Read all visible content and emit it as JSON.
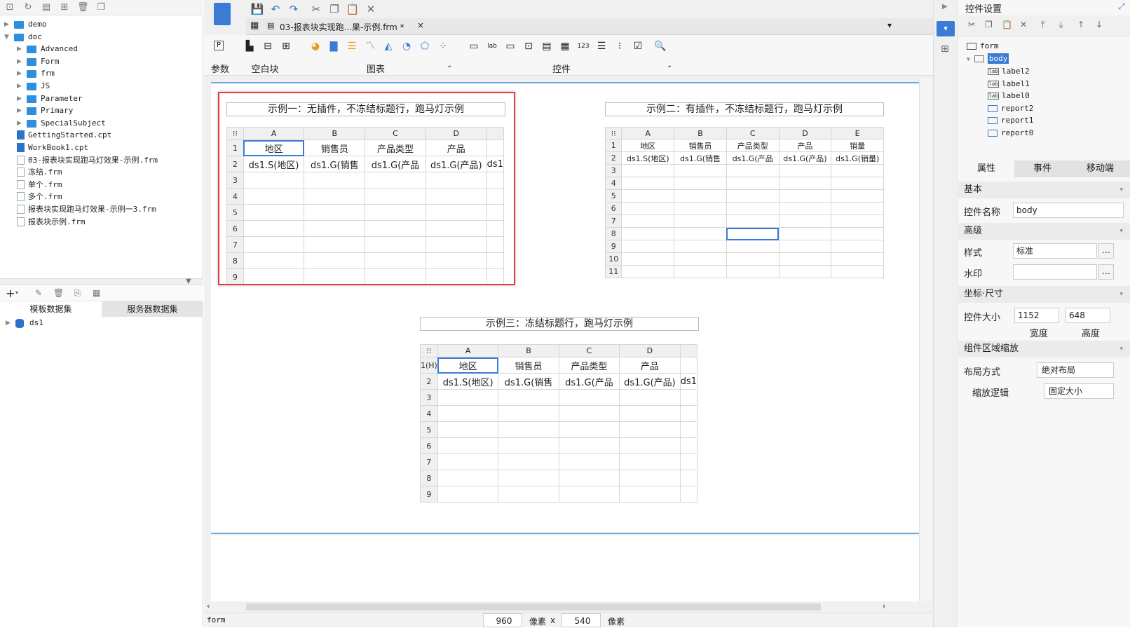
{
  "left_toolbar": {
    "icons": [
      "new-file-icon",
      "refresh-icon",
      "template-icon",
      "add-folder-icon",
      "delete-icon",
      "copy-icon"
    ]
  },
  "tree": [
    {
      "label": "demo",
      "type": "folder",
      "level": 0,
      "expanded": false
    },
    {
      "label": "doc",
      "type": "folder",
      "level": 0,
      "expanded": true
    },
    {
      "label": "Advanced",
      "type": "folder",
      "level": 1
    },
    {
      "label": "Form",
      "type": "folder",
      "level": 1
    },
    {
      "label": "frm",
      "type": "folder",
      "level": 1
    },
    {
      "label": "JS",
      "type": "folder",
      "level": 1
    },
    {
      "label": "Parameter",
      "type": "folder",
      "level": 1
    },
    {
      "label": "Primary",
      "type": "folder",
      "level": 1
    },
    {
      "label": "SpecialSubject",
      "type": "folder",
      "level": 1
    },
    {
      "label": "GettingStarted.cpt",
      "type": "cpt",
      "level": 0
    },
    {
      "label": "WorkBook1.cpt",
      "type": "cpt",
      "level": 0
    },
    {
      "label": "03-报表块实现跑马灯效果-示例.frm",
      "type": "frm",
      "level": 0
    },
    {
      "label": "冻结.frm",
      "type": "frm",
      "level": 0
    },
    {
      "label": "单个.frm",
      "type": "frm",
      "level": 0
    },
    {
      "label": "多个.frm",
      "type": "frm",
      "level": 0
    },
    {
      "label": "报表块实现跑马灯效果-示例一3.frm",
      "type": "frm",
      "level": 0
    },
    {
      "label": "报表块示例.frm",
      "type": "frm",
      "level": 0
    }
  ],
  "dataset_panel": {
    "tabs": [
      "模板数据集",
      "服务器数据集"
    ],
    "active_tab": 0,
    "items": [
      "ds1"
    ]
  },
  "editor_tab": {
    "title": "03-报表块实现跑...果-示例.frm *",
    "close": "×"
  },
  "ribbon": {
    "groups": [
      "参数",
      "空白块",
      "图表",
      "控件"
    ]
  },
  "examples": [
    {
      "title": "示例一：无插件，不冻结标题行，跑马灯示例",
      "cols": [
        "A",
        "B",
        "C",
        "D",
        ""
      ],
      "row_nums": [
        "1",
        "2",
        "3",
        "4",
        "5",
        "6",
        "7",
        "8",
        "9"
      ],
      "row1": [
        "地区",
        "销售员",
        "产品类型",
        "产品",
        ""
      ],
      "row2": [
        "ds1.S(地区)",
        "ds1.G(销售",
        "ds1.G(产品",
        "ds1.G(产品)",
        "ds1"
      ]
    },
    {
      "title": "示例二：有插件，不冻结标题行，跑马灯示例",
      "cols": [
        "A",
        "B",
        "C",
        "D",
        "E"
      ],
      "row_nums": [
        "1",
        "2",
        "3",
        "4",
        "5",
        "6",
        "7",
        "8",
        "9",
        "10",
        "11"
      ],
      "row1": [
        "地区",
        "销售员",
        "产品类型",
        "产品",
        "销量"
      ],
      "row2": [
        "ds1.S(地区)",
        "ds1.G(销售",
        "ds1.G(产品",
        "ds1.G(产品)",
        "ds1.G(销量)"
      ]
    },
    {
      "title": "示例三：冻结标题行，跑马灯示例",
      "cols": [
        "A",
        "B",
        "C",
        "D",
        ""
      ],
      "row_nums": [
        "1(H)",
        "2",
        "3",
        "4",
        "5",
        "6",
        "7",
        "8",
        "9"
      ],
      "row1": [
        "地区",
        "销售员",
        "产品类型",
        "产品",
        ""
      ],
      "row2": [
        "ds1.S(地区)",
        "ds1.G(销售",
        "ds1.G(产品",
        "ds1.G(产品)",
        "ds1"
      ]
    }
  ],
  "status": {
    "label": "form",
    "width": "960",
    "unit1": "像素",
    "x": "x",
    "height": "540",
    "unit2": "像素"
  },
  "right": {
    "title": "控件设置",
    "tree": {
      "root": "form",
      "body": "body",
      "children": [
        "label2",
        "label1",
        "label0",
        "report2",
        "report1",
        "report0"
      ]
    },
    "tabs": [
      "属性",
      "事件",
      "移动端"
    ],
    "sections": {
      "basic": "基本",
      "advanced": "高级",
      "coord": "坐标·尺寸",
      "scale": "组件区域缩放"
    },
    "fields": {
      "name_label": "控件名称",
      "name_value": "body",
      "style_label": "样式",
      "style_value": "标准",
      "watermark_label": "水印",
      "watermark_value": "",
      "size_label": "控件大小",
      "width_value": "1152",
      "height_value": "648",
      "width_caption": "宽度",
      "height_caption": "高度",
      "layout_label": "布局方式",
      "layout_value": "绝对布局",
      "scale_label": "缩放逻辑",
      "scale_value": "固定大小"
    }
  },
  "colors": {
    "accent": "#3a7bd5",
    "highlight_box": "#e23b3b",
    "folder": "#2f8fdc"
  }
}
